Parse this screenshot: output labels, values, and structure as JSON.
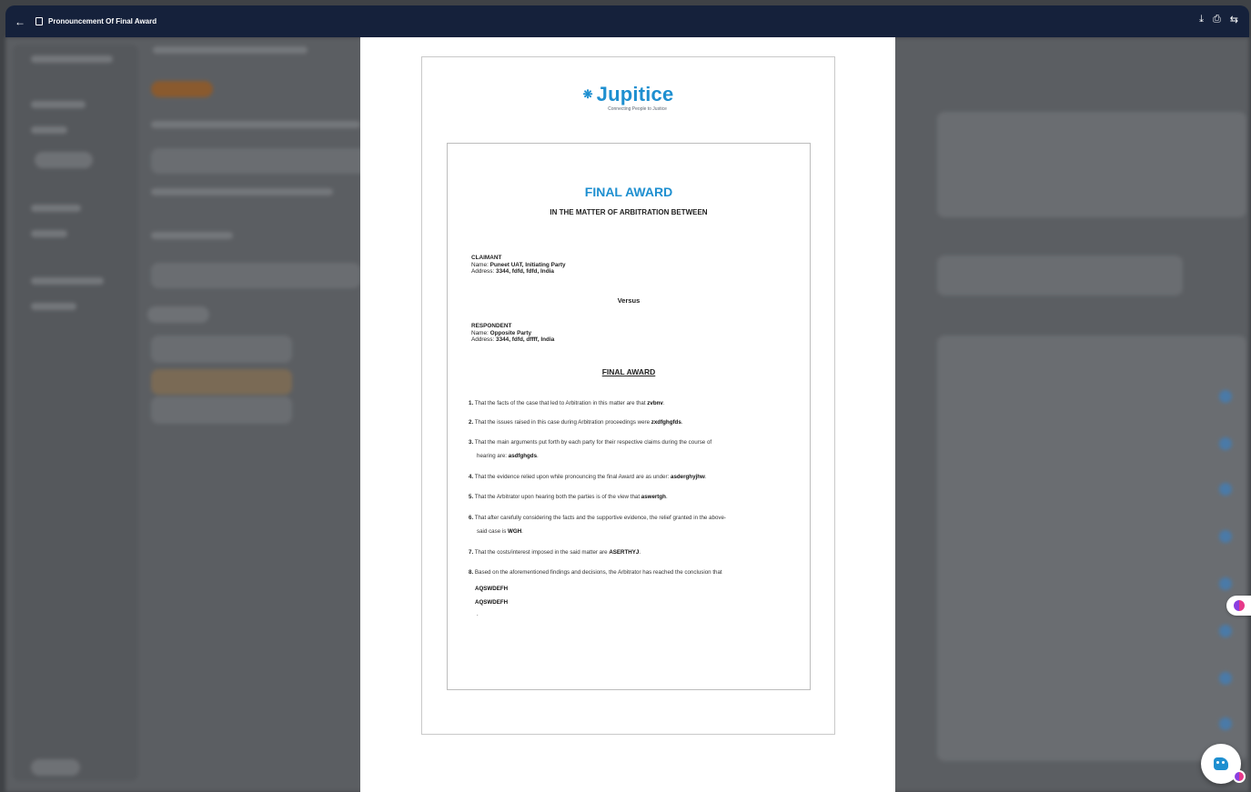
{
  "window": {
    "title": "Pronouncement Of Final Award"
  },
  "icons": {
    "back": "arrow-left-icon",
    "document": "document-icon",
    "download": "download-icon",
    "print": "print-icon",
    "refresh": "refresh-icon"
  },
  "logo": {
    "name": "Jupitice",
    "tagline": "Connecting People to Justice"
  },
  "document": {
    "title": "FINAL AWARD",
    "subtitle": "IN THE MATTER OF ARBITRATION BETWEEN",
    "claimant": {
      "label": "CLAIMANT",
      "name_label": "Name:",
      "name": "Puneet UAT, Initiating Party",
      "address_label": "Address:",
      "address": "3344, fdfd, fdfd, India"
    },
    "versus": "Versus",
    "respondent": {
      "label": "RESPONDENT",
      "name_label": "Name:",
      "name": "Opposite Party",
      "address_label": "Address:",
      "address": "3344, fdfd, dffff, India"
    },
    "section_heading": "FINAL AWARD",
    "items": [
      {
        "num": "1.",
        "text": "That the facts of the case that led to Arbitration in this matter are that ",
        "value": "zvbnv",
        "tail": "."
      },
      {
        "num": "2.",
        "text": "That the issues raised in this case during Arbitration proceedings were ",
        "value": "zxdfghgfds",
        "tail": "."
      },
      {
        "num": "3.",
        "text": "That the main arguments put forth by each party for their respective claims during the course of",
        "cont": "hearing are: ",
        "value": "asdfghgds",
        "tail": "."
      },
      {
        "num": "4.",
        "text": "That the evidence relied upon while pronouncing the final Award are as under: ",
        "value": "asderghyjhw",
        "tail": "."
      },
      {
        "num": "5.",
        "text": "That the Arbitrator upon hearing both the parties is of the view that ",
        "value": "aswertgh",
        "tail": "."
      },
      {
        "num": "6.",
        "text": "That after carefully considering the facts and the supportive evidence, the relief granted in the above-",
        "cont": "said case is ",
        "value": "WGH",
        "tail": "."
      },
      {
        "num": "7.",
        "text": "That the costs/interest imposed in the said matter are ",
        "value": "ASERTHYJ",
        "tail": "."
      },
      {
        "num": "8.",
        "text": "Based on the aforementioned findings and decisions, the Arbitrator has reached the conclusion that"
      }
    ],
    "conclusion_lines": [
      "AQSWDEFH",
      "AQSWDEFH"
    ],
    "end_mark": "."
  },
  "widgets": {
    "brain": "brain-icon",
    "chat": "chatbot-icon"
  }
}
